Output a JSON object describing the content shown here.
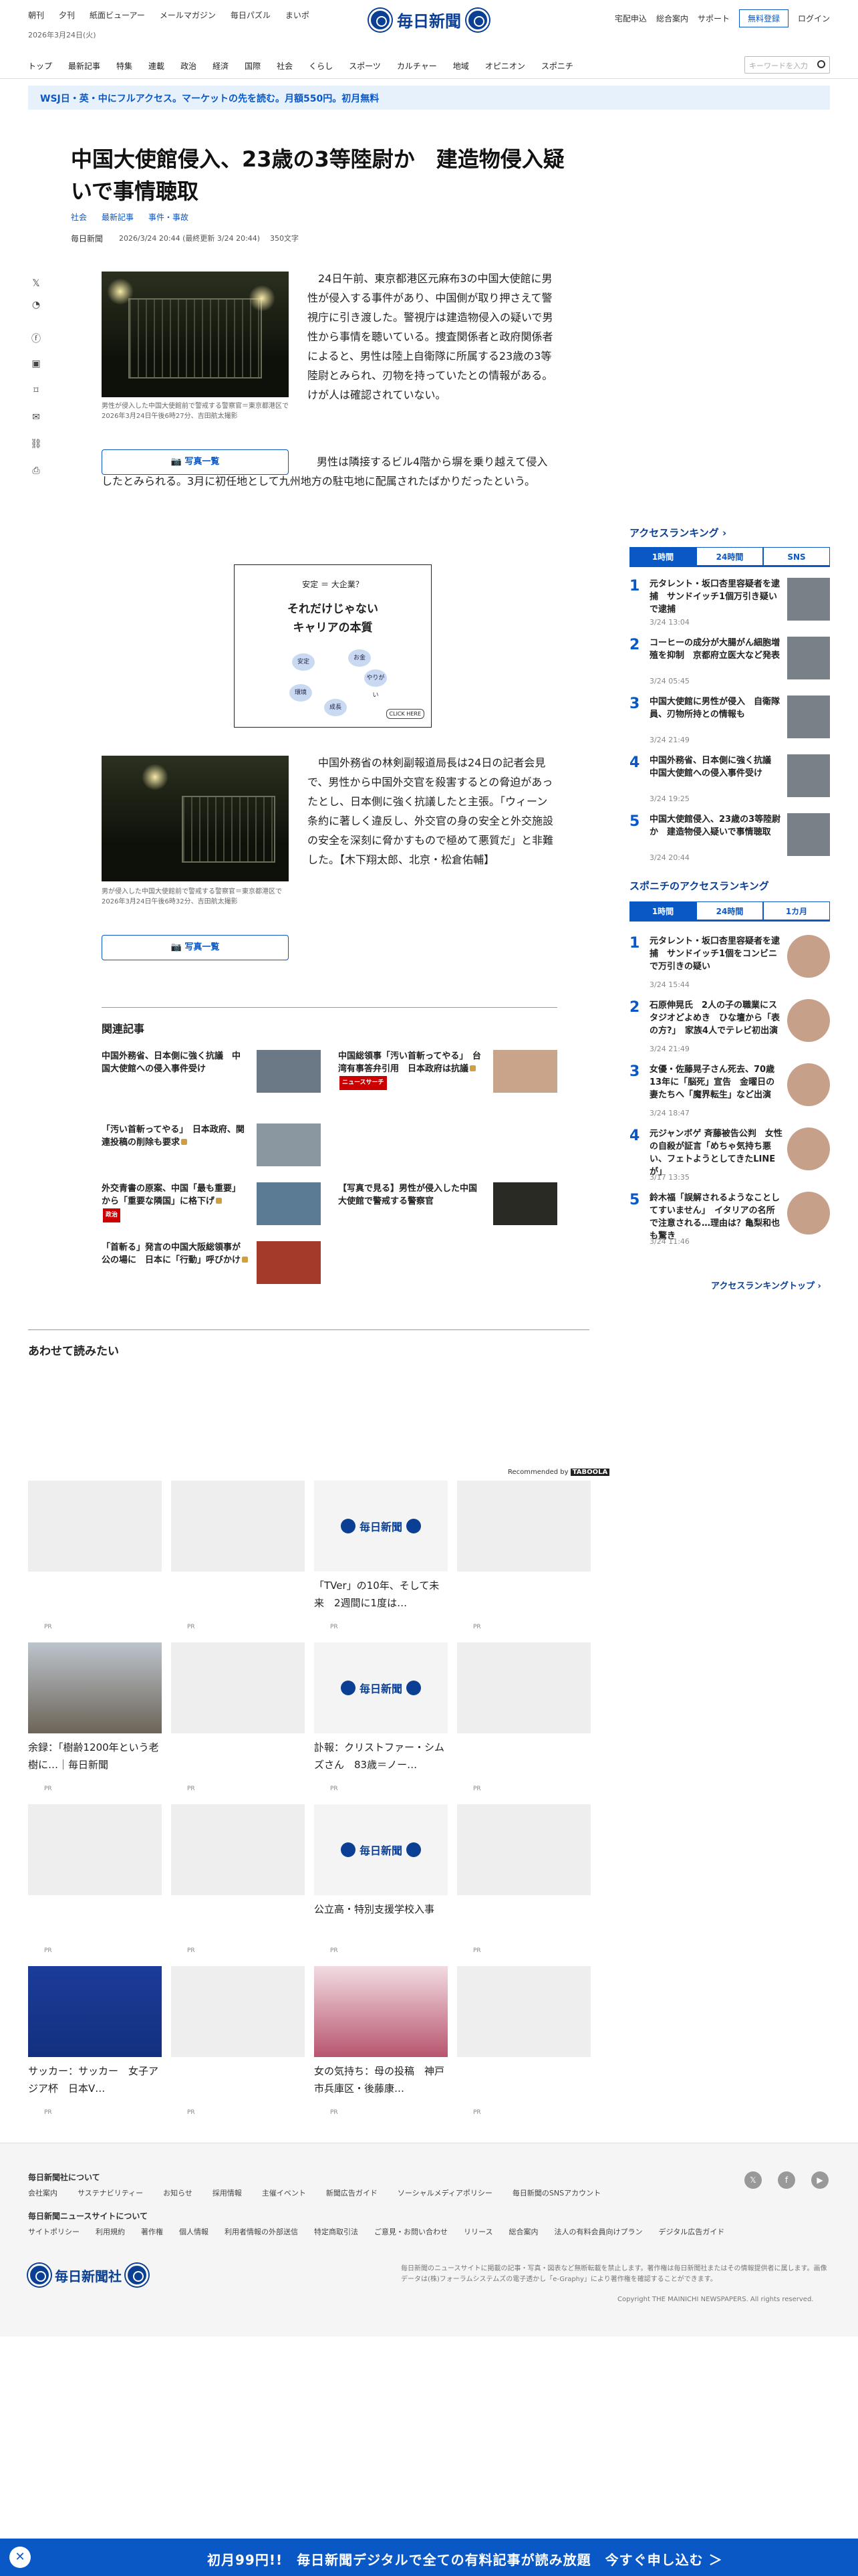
{
  "header": {
    "top_links": [
      "朝刊",
      "夕刊",
      "紙面ビューアー",
      "メールマガジン",
      "毎日パズル",
      "まいポ"
    ],
    "date": "2026年3月24日(火)",
    "logo": "毎日新聞",
    "right_links": [
      "宅配申込",
      "総合案内",
      "サポート"
    ],
    "register_label": "無料登録",
    "login_label": "ログイン",
    "nav": [
      "トップ",
      "最新記事",
      "特集",
      "連載",
      "政治",
      "経済",
      "国際",
      "社会",
      "くらし",
      "スポーツ",
      "カルチャー",
      "地域",
      "オピニオン",
      "スポニチ"
    ],
    "search_placeholder": "キーワードを入力"
  },
  "promo": "WSJ日・英・中にフルアクセス。マーケットの先を読む。月額550円。初月無料",
  "article": {
    "title": "中国大使館侵入、23歳の3等陸尉か　建造物侵入疑いで事情聴取",
    "tags": [
      "社会",
      "最新記事",
      "事件・事故"
    ],
    "source": "毎日新聞",
    "published": "2026/3/24 20:44 (最終更新 3/24 20:44)",
    "char_count": "350文字",
    "photo1_caption": "男性が侵入した中国大使館前で警戒する警察官＝東京都港区で2026年3月24日午後6時27分、吉田航太撮影",
    "photo_button": "写真一覧",
    "para1": "　24日午前、東京都港区元麻布3の中国大使館に男性が侵入する事件があり、中国側が取り押さえて警視庁に引き渡した。警視庁は建造物侵入の疑いで男性から事情を聴いている。捜査関係者と政府関係者によると、男性は陸上自衛隊に所属する23歳の3等陸尉とみられ、刃物を持っていたとの情報がある。けが人は確認されていない。",
    "para2": "　男性は隣接するビル4階から塀を乗り越えて侵入したとみられる。3月に初任地として九州地方の駐屯地に配属されたばかりだったという。",
    "photo2_caption": "男が侵入した中国大使館前で警戒する警察官＝東京都港区で2026年3月24日午後6時32分、吉田航太撮影",
    "para3": "　中国外務省の林剣副報道局長は24日の記者会見で、男性から中国外交官を殺害するとの脅迫があったとし、日本側に強く抗議したと主張。「ウィーン条約に著しく違反し、外交官の身の安全と外交施設の安全を深刻に脅かすもので極めて悪質だ」と非難した。【木下翔太郎、北京・松倉佑輔】"
  },
  "ad": {
    "line1": "安定 ＝ 大企業？",
    "line2": "それだけじゃない",
    "line3": "キャリアの本質",
    "bubbles": [
      "安定",
      "お金",
      "やりがい",
      "環境",
      "成長"
    ],
    "click": "CLICK HERE"
  },
  "related": {
    "heading": "関連記事",
    "items": [
      {
        "title": "中国外務省、日本側に強く抗議　中国大使館への侵入事件受け"
      },
      {
        "title": "中国総領事「汚い首斬ってやる」　台湾有事答弁引用　日本政府は抗議",
        "badge": "ニュースサーチ"
      },
      {
        "title": "「汚い首斬ってやる」　日本政府、関連投稿の削除も要求"
      },
      {
        "title": "外交青書の原案、中国「最も重要」から「重要な隣国」に格下げ",
        "badge": "政治"
      },
      {
        "title": "【写真で見る】男性が侵入した中国大使館で警戒する警察官"
      },
      {
        "title": "「首斬る」発言の中国大阪総領事が公の場に　日本に「行動」呼びかけ"
      }
    ]
  },
  "recommend": {
    "heading": "あわせて読みたい",
    "by": "Recommended by",
    "pr": "PR",
    "tiles": [
      "",
      "",
      "「TVer」の10年、そして未来　2週間に1度は…",
      "",
      "余録：「樹齢1200年という老樹に…｜毎日新聞",
      "",
      "訃報：クリストファー・シムズさん　83歳＝ノー…",
      "",
      "",
      "",
      "公立高・特別支援学校入事",
      "",
      "サッカー：サッカー　女子アジア杯　日本V…",
      "",
      "女の気持ち：母の投稿　神戸市兵庫区・後藤康…",
      ""
    ]
  },
  "sidebar": {
    "ranking_title": "アクセスランキング",
    "tabs": [
      "1時間",
      "24時間",
      "SNS"
    ],
    "ranking": [
      {
        "rank": "1",
        "title": "元タレント・坂口杏里容疑者を逮捕　サンドイッチ1個万引き疑いで逮捕",
        "time": "3/24 13:04"
      },
      {
        "rank": "2",
        "title": "コーヒーの成分が大腸がん細胞増殖を抑制　京都府立医大など発表",
        "time": "3/24 05:45"
      },
      {
        "rank": "3",
        "title": "中国大使館に男性が侵入　自衛隊員、刃物所持との情報も",
        "time": "3/24 21:49"
      },
      {
        "rank": "4",
        "title": "中国外務省、日本側に強く抗議　中国大使館への侵入事件受け",
        "time": "3/24 19:25"
      },
      {
        "rank": "5",
        "title": "中国大使館侵入、23歳の3等陸尉か　建造物侵入疑いで事情聴取",
        "time": "3/24 20:44"
      }
    ],
    "spo_title": "スポニチのアクセスランキング",
    "spo_tabs": [
      "1時間",
      "24時間",
      "1カ月"
    ],
    "spo": [
      {
        "rank": "1",
        "title": "元タレント・坂口杏里容疑者を逮捕　サンドイッチ1個をコンビニで万引きの疑い",
        "time": "3/24 15:44"
      },
      {
        "rank": "2",
        "title": "石原伸晃氏　2人の子の職業にスタジオどよめき　ひな壇から「表の方?」　家族4人でテレビ初出演",
        "time": "3/24 21:49"
      },
      {
        "rank": "3",
        "title": "女優・佐藤晃子さん死去、70歳　13年に「脳死」宣告　金曜日の妻たちへ「魔界転生」など出演",
        "time": "3/24 18:47"
      },
      {
        "rank": "4",
        "title": "元ジャンボゲ 斉藤被告公判　女性の自殺が証言「めちゃ気持ち悪い、フェトようとしてきたLINEが」",
        "time": "3/17 13:35"
      },
      {
        "rank": "5",
        "title": "鈴木福「誤解されるようなことしてすいません」　イタリアの名所で注意される…理由は？亀梨和也も驚き",
        "time": "3/24 11:46"
      }
    ],
    "more": "アクセスランキングトップ"
  },
  "footer": {
    "about": "毎日新聞社について",
    "about_links": [
      "会社案内",
      "サステナビリティー",
      "お知らせ",
      "採用情報",
      "主催イベント",
      "新聞広告ガイド",
      "ソーシャルメディアポリシー",
      "毎日新聞のSNSアカウント"
    ],
    "site": "毎日新聞ニュースサイトについて",
    "site_links": [
      "サイトポリシー",
      "利用規約",
      "著作権",
      "個人情報",
      "利用者情報の外部送信",
      "特定商取引法",
      "ご意見・お問い合わせ",
      "リリース",
      "総合案内",
      "法人の有料会員向けプラン",
      "デジタル広告ガイド"
    ],
    "company": "毎日新聞社",
    "notice": "毎日新聞のニュースサイトに掲載の記事・写真・図表など無断転載を禁止します。著作権は毎日新聞社またはその情報提供者に属します。画像データは(株)フォーラムシステムズの電子透かし「e-Graphy」により著作権を確認することができます。",
    "copyright": "Copyright THE MAINICHI NEWSPAPERS. All rights reserved."
  },
  "bottom_bar": {
    "close": "✕",
    "text": "初月99円!!　毎日新聞デジタルで全ての有料記事が読み放題　今すぐ申し込む ＞"
  }
}
